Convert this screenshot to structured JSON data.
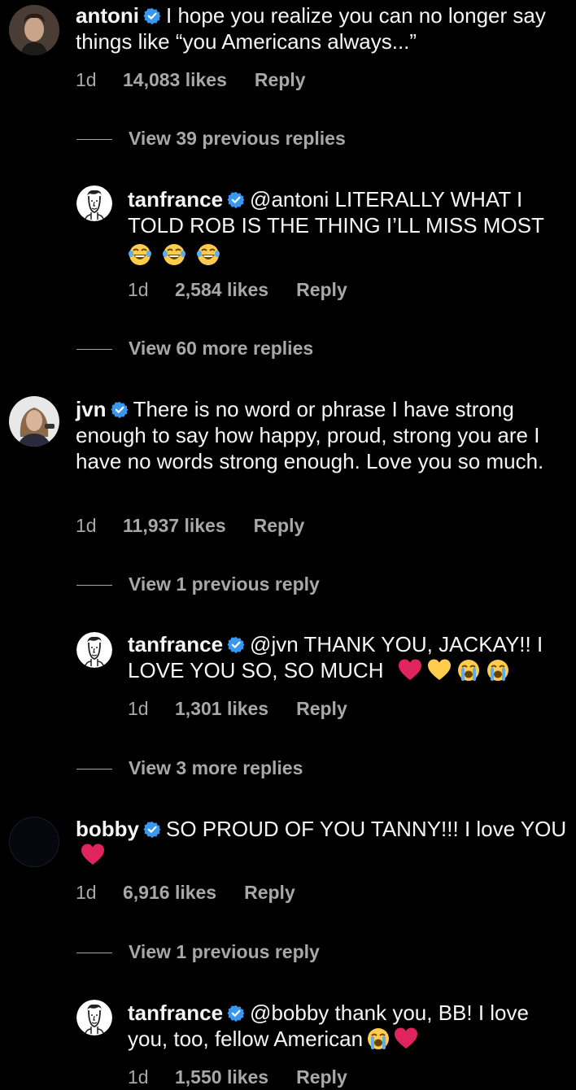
{
  "comments": [
    {
      "username": "antoni",
      "text": "I hope you realize you can no longer say things like “you Americans always...”",
      "time": "1d",
      "likes": "14,083 likes",
      "reply": "Reply",
      "view_replies": "View 39 previous replies",
      "reply_item": {
        "username": "tanfrance",
        "text": "@antoni LITERALLY WHAT I TOLD ROB IS THE THING I’LL MISS MOST",
        "time": "1d",
        "likes": "2,584 likes",
        "reply": "Reply"
      },
      "more_replies": "View 60 more replies"
    },
    {
      "username": "jvn",
      "text": "There is no word or phrase I have strong enough to say how happy, proud, strong you are I have no words strong enough. Love you so much.",
      "time": "1d",
      "likes": "11,937 likes",
      "reply": "Reply",
      "view_replies": "View 1 previous reply",
      "reply_item": {
        "username": "tanfrance",
        "text": "@jvn THANK YOU, JACKAY!! I LOVE YOU SO, SO MUCH",
        "time": "1d",
        "likes": "1,301 likes",
        "reply": "Reply"
      },
      "more_replies": "View 3 more replies"
    },
    {
      "username": "bobby",
      "text": "SO PROUD OF YOU TANNY!!! I love YOU",
      "time": "1d",
      "likes": "6,916 likes",
      "reply": "Reply",
      "view_replies": "View 1 previous reply",
      "reply_item": {
        "username": "tanfrance",
        "text": "@bobby thank you, BB! I love you, too, fellow American",
        "time": "1d",
        "likes": "1,550 likes",
        "reply": "Reply"
      }
    }
  ],
  "icons": {
    "verified": "verified-badge-icon",
    "laughing": "laughing-tears-emoji",
    "red_heart": "red-heart-emoji",
    "yellow_heart": "yellow-heart-emoji",
    "crying": "loudly-crying-emoji"
  },
  "colors": {
    "background": "#000000",
    "text": "#f5f5f5",
    "secondary": "#a8a8a8",
    "verified": "#3897f0",
    "heart_red": "#e0245e",
    "heart_yellow": "#ffcc4d"
  }
}
